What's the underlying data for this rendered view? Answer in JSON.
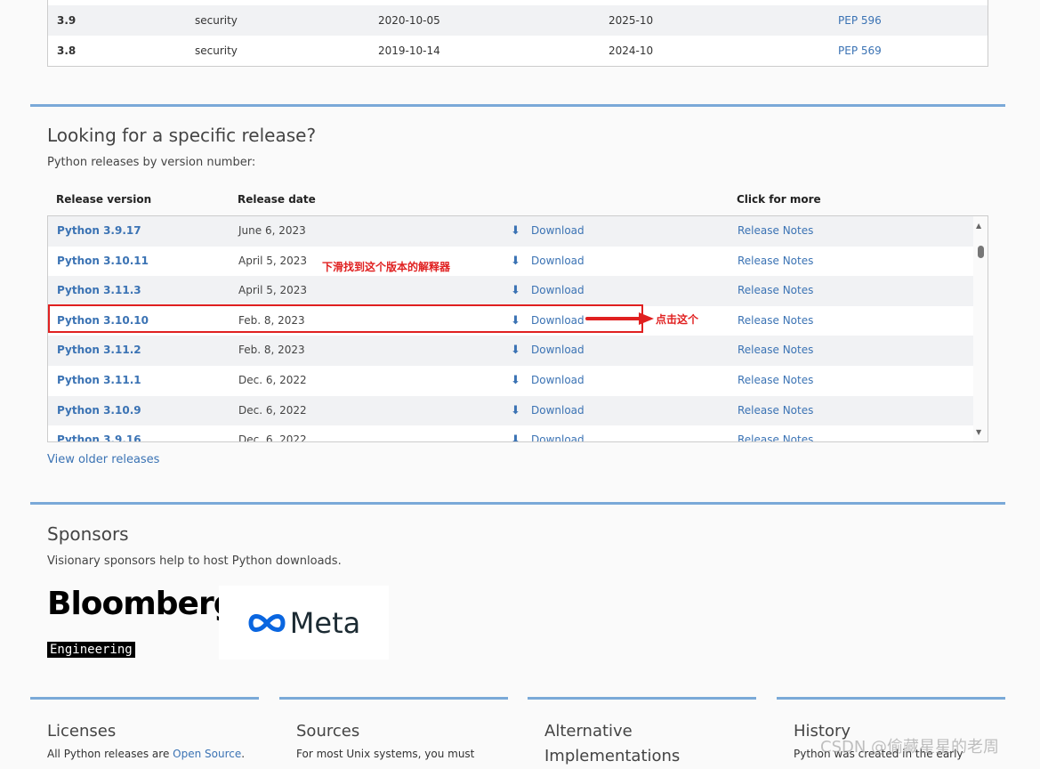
{
  "status_table": {
    "rows": [
      {
        "version": "3.9",
        "status": "security",
        "first_released": "2020-10-05",
        "end_of_support": "2025-10",
        "pep": "PEP 596"
      },
      {
        "version": "3.8",
        "status": "security",
        "first_released": "2019-10-14",
        "end_of_support": "2024-10",
        "pep": "PEP 569"
      }
    ]
  },
  "releases": {
    "title": "Looking for a specific release?",
    "subtitle": "Python releases by version number:",
    "headers": {
      "version": "Release version",
      "date": "Release date",
      "more": "Click for more"
    },
    "rows": [
      {
        "version": "Python 3.9.17",
        "date": "June 6, 2023",
        "download": "Download",
        "notes": "Release Notes"
      },
      {
        "version": "Python 3.10.11",
        "date": "April 5, 2023",
        "download": "Download",
        "notes": "Release Notes"
      },
      {
        "version": "Python 3.11.3",
        "date": "April 5, 2023",
        "download": "Download",
        "notes": "Release Notes"
      },
      {
        "version": "Python 3.10.10",
        "date": "Feb. 8, 2023",
        "download": "Download",
        "notes": "Release Notes"
      },
      {
        "version": "Python 3.11.2",
        "date": "Feb. 8, 2023",
        "download": "Download",
        "notes": "Release Notes"
      },
      {
        "version": "Python 3.11.1",
        "date": "Dec. 6, 2022",
        "download": "Download",
        "notes": "Release Notes"
      },
      {
        "version": "Python 3.10.9",
        "date": "Dec. 6, 2022",
        "download": "Download",
        "notes": "Release Notes"
      },
      {
        "version": "Python 3.9.16",
        "date": "Dec. 6, 2022",
        "download": "Download",
        "notes": "Release Notes"
      }
    ],
    "older_link": "View older releases"
  },
  "annotations": {
    "scroll_hint": "下滑找到这个版本的解释器",
    "click_hint": "点击这个",
    "color": "#e02020"
  },
  "sponsors": {
    "title": "Sponsors",
    "subtitle": "Visionary sponsors help to host Python downloads.",
    "bloomberg": "Bloomberg",
    "bloomberg_sub": "Engineering",
    "meta": "Meta"
  },
  "footer": [
    {
      "title": "Licenses",
      "text": "All Python releases are ",
      "link": "Open Source",
      "after": "."
    },
    {
      "title": "Sources",
      "text": "For most Unix systems, you must"
    },
    {
      "title": "Alternative Implementations",
      "text": ""
    },
    {
      "title": "History",
      "text": "Python was created in the early"
    }
  ],
  "watermark": "CSDN @偷藏星星的老周"
}
